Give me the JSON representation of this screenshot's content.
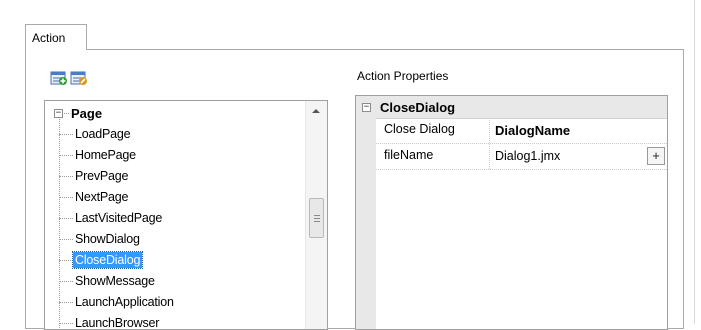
{
  "tabs": [
    {
      "label": "Action",
      "active": true
    }
  ],
  "toolbar": {
    "icons": [
      "add-action-icon",
      "edit-action-icon"
    ]
  },
  "tree": {
    "root": {
      "label": "Page",
      "expanded": true,
      "expander": "⊟"
    },
    "items": [
      {
        "label": "LoadPage",
        "selected": false
      },
      {
        "label": "HomePage",
        "selected": false
      },
      {
        "label": "PrevPage",
        "selected": false
      },
      {
        "label": "NextPage",
        "selected": false
      },
      {
        "label": "LastVisitedPage",
        "selected": false
      },
      {
        "label": "ShowDialog",
        "selected": false
      },
      {
        "label": "CloseDialog",
        "selected": true
      },
      {
        "label": "ShowMessage",
        "selected": false
      },
      {
        "label": "LaunchApplication",
        "selected": false
      },
      {
        "label": "LaunchBrowser",
        "selected": false
      }
    ]
  },
  "properties": {
    "title": "Action Properties",
    "group": {
      "name": "CloseDialog",
      "expander": "⊟"
    },
    "rows": [
      {
        "name": "Close Dialog",
        "value": "DialogName",
        "bold": true,
        "has_button": false
      },
      {
        "name": "fileName",
        "value": "Dialog1.jmx",
        "bold": false,
        "has_button": true,
        "button_label": "+"
      }
    ]
  },
  "colors": {
    "selection": "#3399ff",
    "group_background": "#e8e8e8",
    "border": "#a0a0a0"
  }
}
